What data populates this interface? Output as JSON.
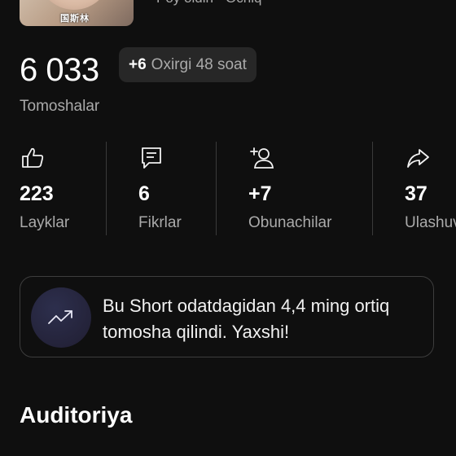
{
  "video": {
    "thumbnail_overlay_text": "国斯林",
    "meta_text": "Poy oldin · Ochiq"
  },
  "views": {
    "count": "6 033",
    "delta": "+6",
    "period": "Oxirgi 48 soat",
    "label": "Tomoshalar"
  },
  "stats": [
    {
      "icon": "thumbs-up-icon",
      "value": "223",
      "label": "Layklar"
    },
    {
      "icon": "comment-icon",
      "value": "6",
      "label": "Fikrlar"
    },
    {
      "icon": "person-add-icon",
      "value": "+7",
      "label": "Obunachilar"
    },
    {
      "icon": "share-icon",
      "value": "37",
      "label": "Ulashuvlar"
    }
  ],
  "insight": {
    "icon": "trending-up-icon",
    "text": "Bu Short odatdagidan 4,4 ming ortiq tomosha qilindi. Yaxshi!"
  },
  "section": {
    "title": "Auditoriya"
  },
  "colors": {
    "background": "#0f0f0f",
    "chip": "#272727",
    "secondary_text": "#aaaaaa",
    "insight_icon_bg": "#24233a"
  }
}
